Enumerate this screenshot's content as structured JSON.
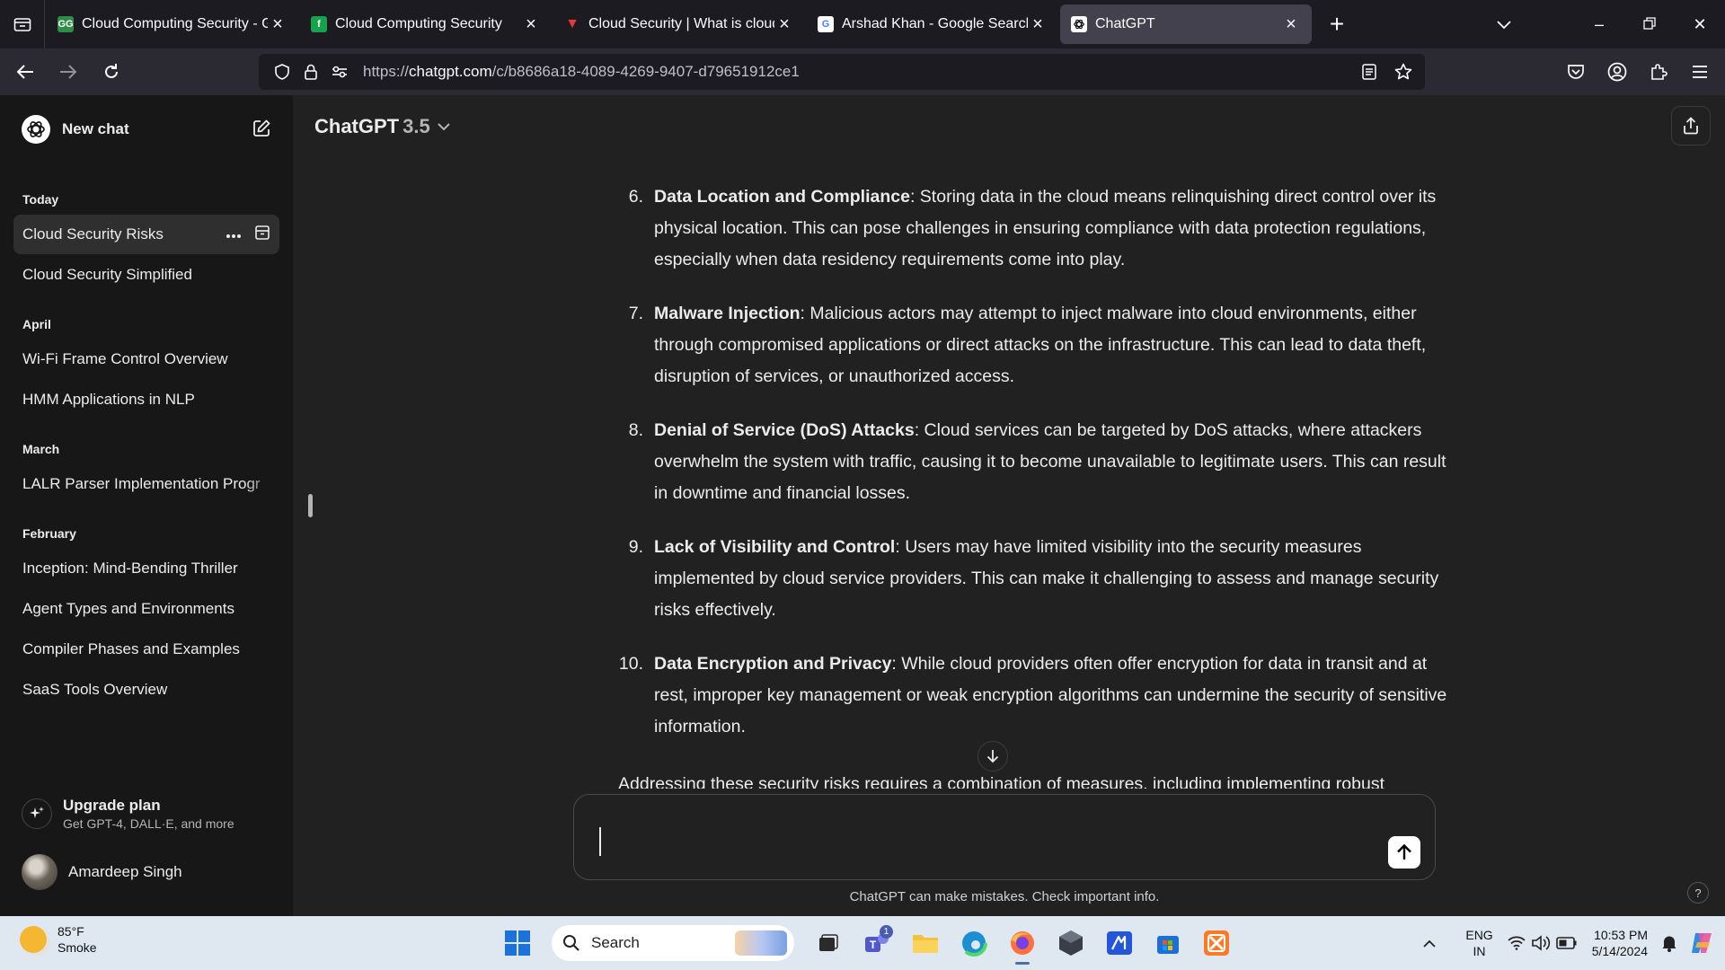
{
  "browser": {
    "tabs": [
      {
        "title": "Cloud Computing Security - Gee",
        "favicon_color": "#2f8d46",
        "favicon_text": "GG",
        "active": false
      },
      {
        "title": "Cloud Computing Security",
        "favicon_color": "#17a34a",
        "favicon_text": "f",
        "active": false
      },
      {
        "title": "Cloud Security | What is cloud s",
        "favicon_color": "#d32f2f",
        "favicon_text": "▼",
        "active": false
      },
      {
        "title": "Arshad Khan - Google Search",
        "favicon_color": "#ffffff",
        "favicon_text": "G",
        "active": false
      },
      {
        "title": "ChatGPT",
        "favicon_color": "#ffffff",
        "favicon_text": "",
        "active": true
      }
    ],
    "url_prefix": "https://",
    "url_host": "chatgpt.com",
    "url_path": "/c/b8686a18-4089-4269-9407-d79651912ce1"
  },
  "sidebar": {
    "new_chat_label": "New chat",
    "sections": [
      {
        "heading": "Today",
        "items": [
          "Cloud Security Risks",
          "Cloud Security Simplified"
        ]
      },
      {
        "heading": "April",
        "items": [
          "Wi-Fi Frame Control Overview",
          "HMM Applications in NLP"
        ]
      },
      {
        "heading": "March",
        "items": [
          "LALR Parser Implementation Progr"
        ]
      },
      {
        "heading": "February",
        "items": [
          "Inception: Mind-Bending Thriller",
          "Agent Types and Environments",
          "Compiler Phases and Examples",
          "SaaS Tools Overview"
        ]
      }
    ],
    "upgrade": {
      "title": "Upgrade plan",
      "subtitle": "Get GPT-4, DALL·E, and more"
    },
    "user_name": "Amardeep Singh"
  },
  "main": {
    "model_name": "ChatGPT",
    "model_version": "3.5",
    "items": [
      {
        "num": "6.",
        "title": "Data Location and Compliance",
        "text": ": Storing data in the cloud means relinquishing direct control over its physical location. This can pose challenges in ensuring compliance with data protection regulations, especially when data residency requirements come into play."
      },
      {
        "num": "7.",
        "title": "Malware Injection",
        "text": ": Malicious actors may attempt to inject malware into cloud environments, either through compromised applications or direct attacks on the infrastructure. This can lead to data theft, disruption of services, or unauthorized access."
      },
      {
        "num": "8.",
        "title": "Denial of Service (DoS) Attacks",
        "text": ": Cloud services can be targeted by DoS attacks, where attackers overwhelm the system with traffic, causing it to become unavailable to legitimate users. This can result in downtime and financial losses."
      },
      {
        "num": "9.",
        "title": "Lack of Visibility and Control",
        "text": ": Users may have limited visibility into the security measures implemented by cloud service providers. This can make it challenging to assess and manage security risks effectively."
      },
      {
        "num": "10.",
        "title": "Data Encryption and Privacy",
        "text": ": While cloud providers often offer encryption for data in transit and at rest, improper key management or weak encryption algorithms can undermine the security of sensitive information."
      }
    ],
    "closing_line": "Addressing these security risks requires a combination of measures, including implementing robust",
    "composer_value": "",
    "disclaimer": "ChatGPT can make mistakes. Check important info.",
    "help_label": "?"
  },
  "taskbar": {
    "weather_temp": "85°F",
    "weather_desc": "Smoke",
    "search_label": "Search",
    "teams_badge": "1",
    "lang_line1": "ENG",
    "lang_line2": "IN",
    "time": "10:53 PM",
    "date": "5/14/2024"
  }
}
